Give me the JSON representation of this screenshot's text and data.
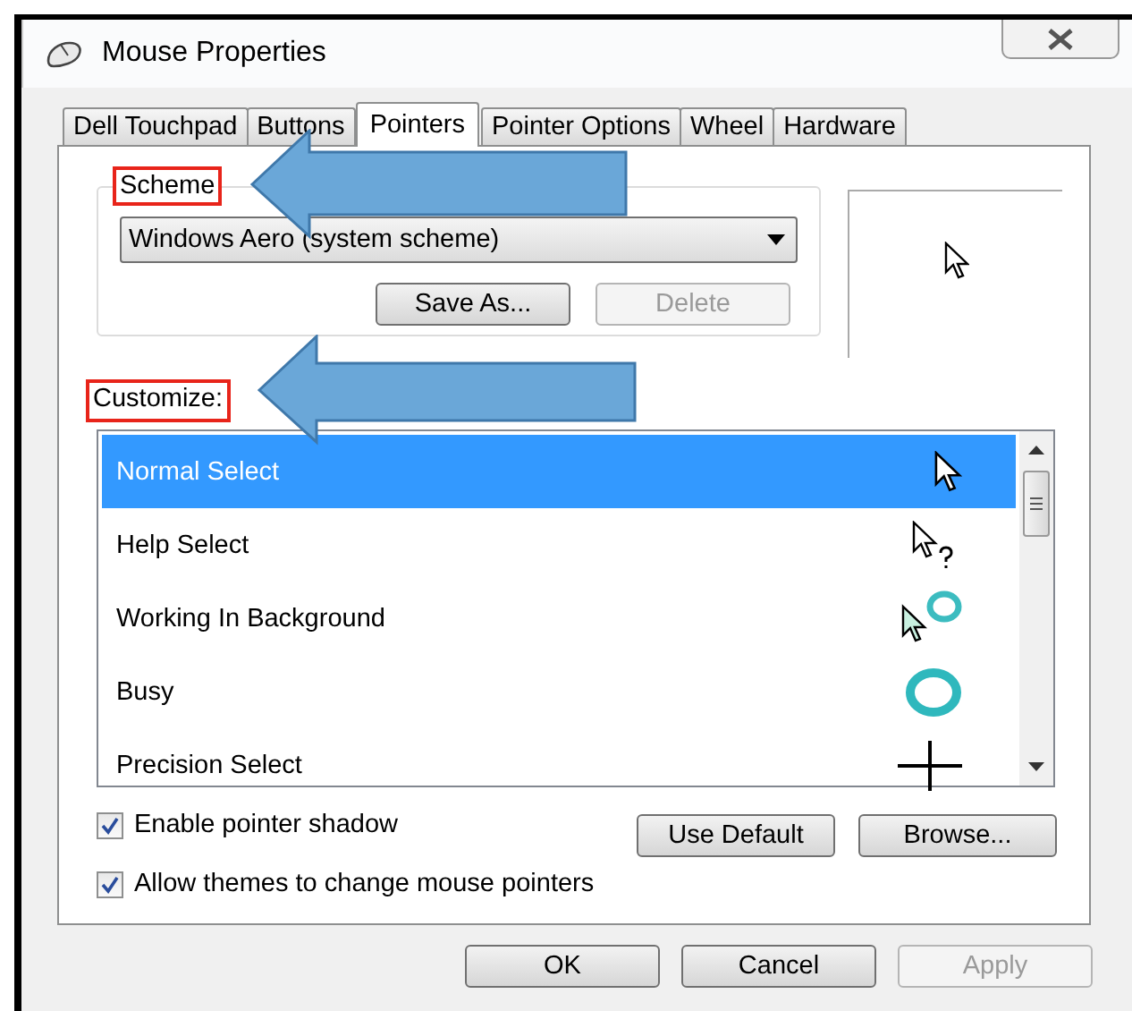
{
  "window": {
    "title": "Mouse Properties"
  },
  "tabs": [
    {
      "label": "Dell Touchpad",
      "selected": false
    },
    {
      "label": "Buttons",
      "selected": false
    },
    {
      "label": "Pointers",
      "selected": true
    },
    {
      "label": "Pointer Options",
      "selected": false
    },
    {
      "label": "Wheel",
      "selected": false
    },
    {
      "label": "Hardware",
      "selected": false
    }
  ],
  "scheme": {
    "label": "Scheme",
    "highlighted": true,
    "value": "Windows Aero (system scheme)",
    "buttons": [
      {
        "label": "Save As...",
        "disabled": false
      },
      {
        "label": "Delete",
        "disabled": true
      }
    ]
  },
  "customize": {
    "label": "Customize:",
    "highlighted": true,
    "items": [
      {
        "name": "Normal Select",
        "kind": "arrow",
        "selected": true
      },
      {
        "name": "Help Select",
        "kind": "help",
        "selected": false
      },
      {
        "name": "Working In Background",
        "kind": "working",
        "selected": false
      },
      {
        "name": "Busy",
        "kind": "busy",
        "selected": false
      },
      {
        "name": "Precision Select",
        "kind": "precision",
        "selected": false
      }
    ]
  },
  "options": [
    {
      "label": "Enable pointer shadow",
      "checked": true
    },
    {
      "label": "Allow themes to change mouse pointers",
      "checked": true
    }
  ],
  "pointer_buttons": [
    {
      "label": "Use Default",
      "disabled": false
    },
    {
      "label": "Browse...",
      "disabled": false
    }
  ],
  "footer_buttons": [
    {
      "label": "OK",
      "disabled": false
    },
    {
      "label": "Cancel",
      "disabled": false
    },
    {
      "label": "Apply",
      "disabled": true
    }
  ]
}
